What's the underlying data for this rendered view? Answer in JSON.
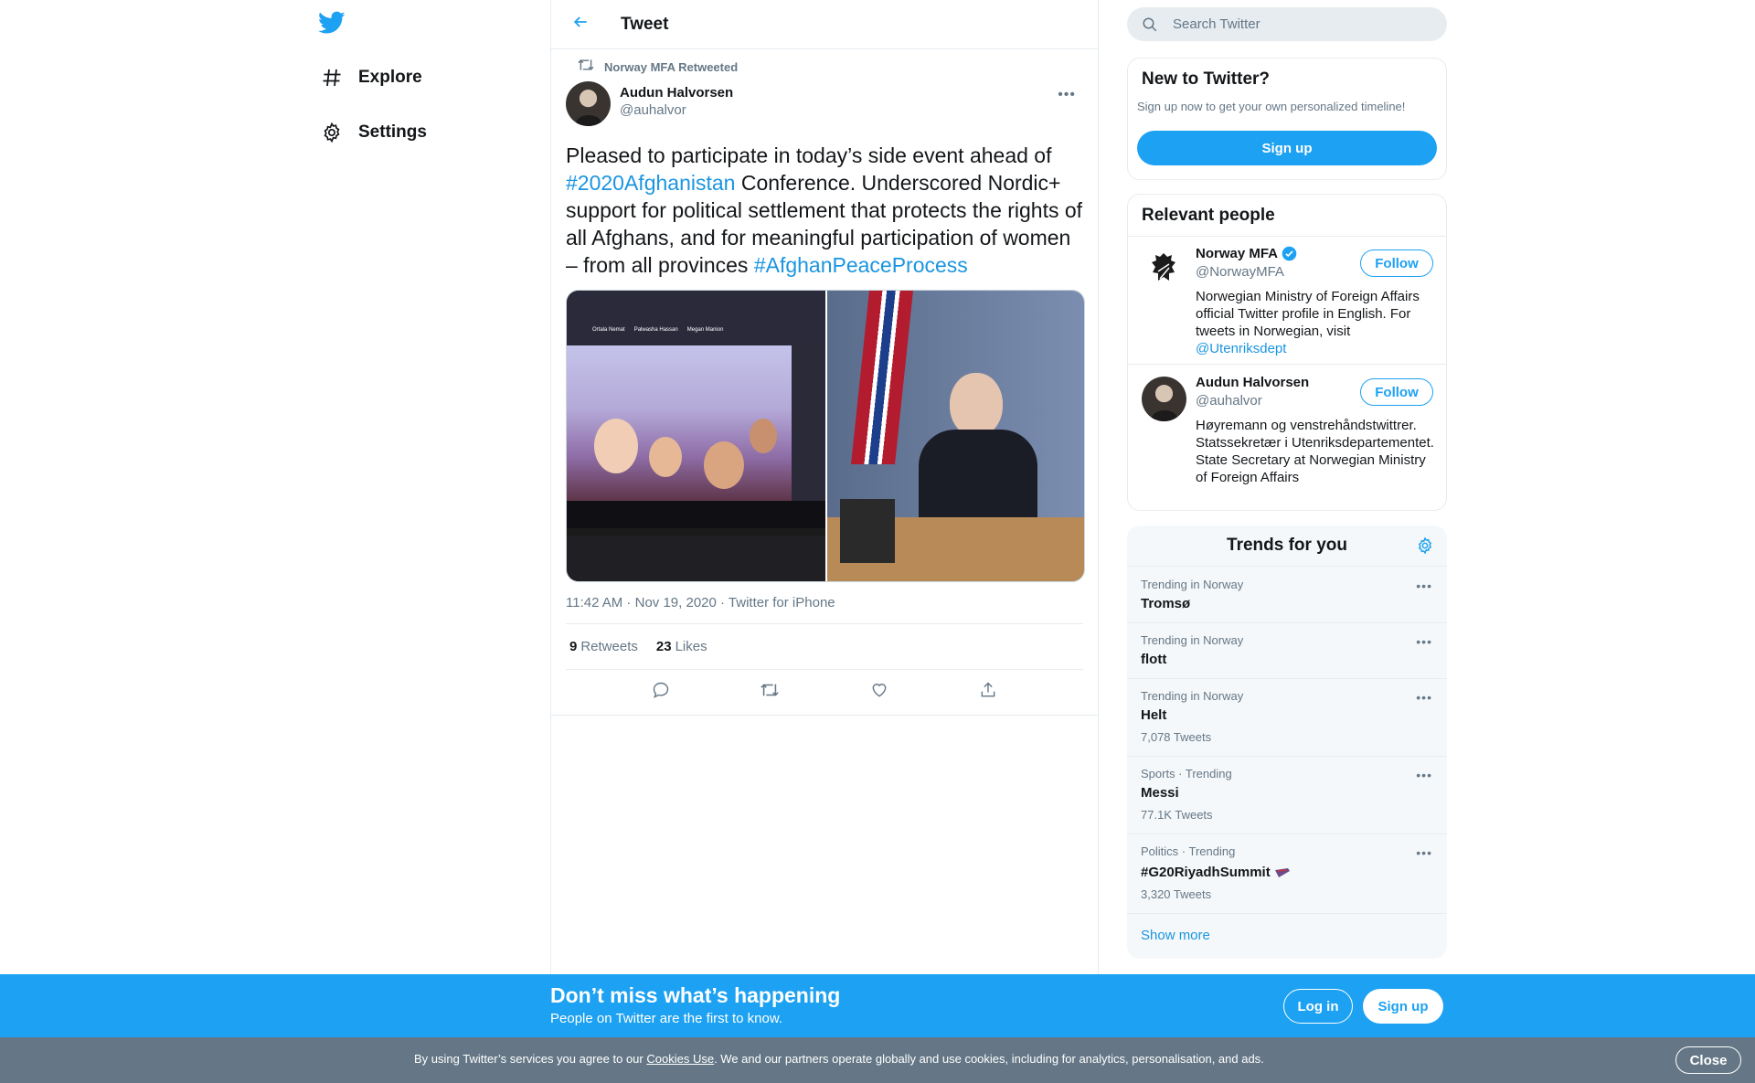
{
  "nav": {
    "logo_icon": "twitter-bird-icon",
    "items": [
      {
        "label": "Explore",
        "icon": "hashtag-icon"
      },
      {
        "label": "Settings",
        "icon": "gear-icon"
      }
    ]
  },
  "header": {
    "back_icon": "arrow-left-icon",
    "title": "Tweet"
  },
  "tweet": {
    "retweeted_by": "Norway MFA Retweeted",
    "author_name": "Audun Halvorsen",
    "author_handle": "@auhalvor",
    "text_1": "Pleased to participate in today’s side event ahead of ",
    "tag_1": "#2020Afghanistan",
    "text_2": " Conference. Underscored Nordic+ support for political settlement that protects the rights of all Afghans, and for meaningful participation of women – from all provinces ",
    "tag_2": "#AfghanPeaceProcess",
    "zoom_names": [
      "Ortala Nemat",
      "Palwasha Hassan",
      "Megan Manion"
    ],
    "time": "11:42 AM",
    "date": "Nov 19, 2020",
    "source": "Twitter for iPhone",
    "retweets_count": "9",
    "retweets_label": "Retweets",
    "likes_count": "23",
    "likes_label": "Likes"
  },
  "search": {
    "placeholder": "Search Twitter"
  },
  "new_to_twitter": {
    "title": "New to Twitter?",
    "subtitle": "Sign up now to get your own personalized timeline!",
    "signup_label": "Sign up"
  },
  "relevant_people": {
    "title": "Relevant people",
    "people": [
      {
        "name": "Norway MFA",
        "handle": "@NorwayMFA",
        "bio": "Norwegian Ministry of Foreign Affairs official Twitter profile in English. For tweets in Norwegian, visit ",
        "bio_link": "@Utenriksdept",
        "follow_label": "Follow"
      },
      {
        "name": "Audun Halvorsen",
        "handle": "@auhalvor",
        "bio": "Høyremann og venstrehåndstwittrer. Statssekretær i Utenriksdepartementet. State Secretary at Norwegian Ministry of Foreign Affairs",
        "follow_label": "Follow"
      }
    ]
  },
  "trends": {
    "title": "Trends for you",
    "items": [
      {
        "context": "Trending in Norway",
        "name": "Tromsø",
        "count": ""
      },
      {
        "context": "Trending in Norway",
        "name": "flott",
        "count": ""
      },
      {
        "context": "Trending in Norway",
        "name": "Helt",
        "count": "7,078 Tweets"
      },
      {
        "context": "Sports · Trending",
        "name": "Messi",
        "count": "77.1K Tweets"
      },
      {
        "context": "Politics · Trending",
        "name": "#G20RiyadhSummit",
        "count": "3,320 Tweets"
      }
    ],
    "show_more": "Show more"
  },
  "promo": {
    "title": "Don’t miss what’s happening",
    "subtitle": "People on Twitter are the first to know.",
    "login_label": "Log in",
    "signup_label": "Sign up"
  },
  "cookie": {
    "text_before": "By using Twitter’s services you agree to our ",
    "link": "Cookies Use",
    "text_after": ". We and our partners operate globally and use cookies, including for analytics, personalisation, and ads.",
    "close_label": "Close"
  },
  "colors": {
    "brand": "#1da1f2",
    "link": "#1b95e0",
    "muted": "#657786",
    "border": "#e6ecf0",
    "cookie_bar": "#657786"
  }
}
